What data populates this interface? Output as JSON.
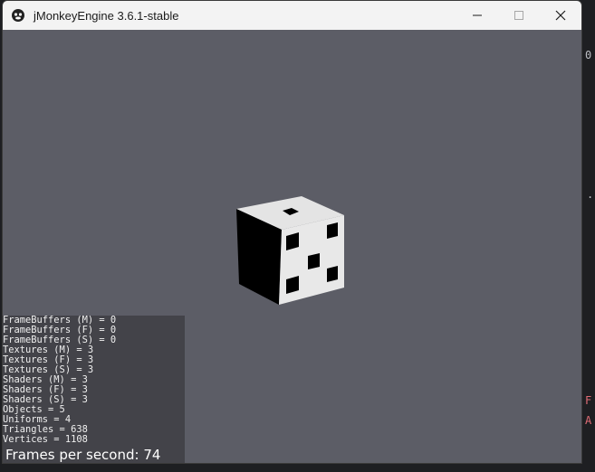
{
  "window": {
    "title": "jMonkeyEngine 3.6.1-stable"
  },
  "controls": {
    "minimize_icon": "minimize-icon",
    "maximize_icon": "maximize-icon",
    "close_icon": "close-icon"
  },
  "background": {
    "glyph_1": "0",
    "glyph_2": ".",
    "glyph_3": "F",
    "glyph_4": "A"
  },
  "stats": {
    "lines": [
      "FrameBuffers (M) = 0",
      "FrameBuffers (F) = 0",
      "FrameBuffers (S) = 0",
      "Textures (M) = 3",
      "Textures (F) = 3",
      "Textures (S) = 3",
      "Shaders (M) = 3",
      "Shaders (F) = 3",
      "Shaders (S) = 3",
      "Objects = 5",
      "Uniforms = 4",
      "Triangles = 638",
      "Vertices = 1108"
    ],
    "fps": "Frames per second: 74"
  },
  "colors": {
    "viewport_bg": "#5c5d66",
    "stats_bg": "#434349",
    "die_face": "#e6e6e6",
    "pip": "#000000"
  }
}
